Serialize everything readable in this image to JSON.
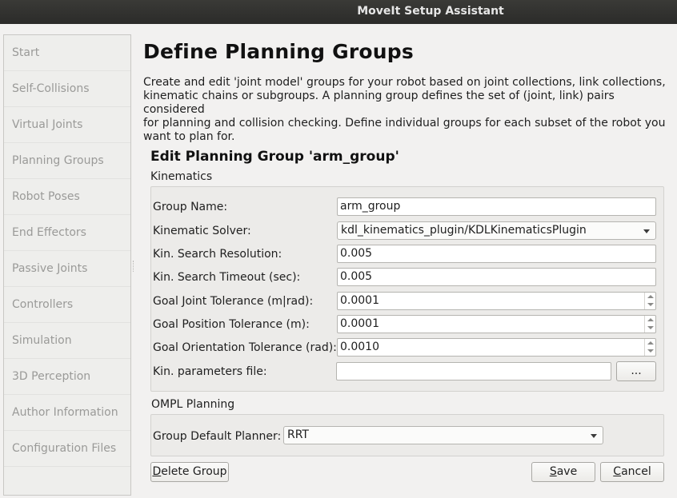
{
  "window": {
    "title": "MoveIt Setup Assistant"
  },
  "sidebar": {
    "items": [
      {
        "label": "Start"
      },
      {
        "label": "Self-Collisions"
      },
      {
        "label": "Virtual Joints"
      },
      {
        "label": "Planning Groups"
      },
      {
        "label": "Robot Poses"
      },
      {
        "label": "End Effectors"
      },
      {
        "label": "Passive Joints"
      },
      {
        "label": "Controllers"
      },
      {
        "label": "Simulation"
      },
      {
        "label": "3D Perception"
      },
      {
        "label": "Author Information"
      },
      {
        "label": "Configuration Files"
      }
    ]
  },
  "main": {
    "title": "Define Planning Groups",
    "description_lines": [
      "Create and edit 'joint model' groups for your robot based on joint collections, link collections,",
      "kinematic chains or subgroups. A planning group defines the set of (joint, link) pairs considered",
      "for planning and collision checking. Define individual groups for each subset of the robot you",
      "want to plan for."
    ],
    "edit_title": "Edit Planning Group 'arm_group'",
    "kinematics": {
      "label": "Kinematics",
      "group_name": {
        "label": "Group Name:",
        "value": "arm_group"
      },
      "solver": {
        "label": "Kinematic Solver:",
        "value": "kdl_kinematics_plugin/KDLKinematicsPlugin"
      },
      "search_resolution": {
        "label": "Kin. Search Resolution:",
        "value": "0.005"
      },
      "search_timeout": {
        "label": "Kin. Search Timeout (sec):",
        "value": "0.005"
      },
      "goal_joint_tol": {
        "label": "Goal Joint Tolerance (m|rad):",
        "value": "0.0001"
      },
      "goal_position_tol": {
        "label": "Goal Position Tolerance (m):",
        "value": "0.0001"
      },
      "goal_orientation_tol": {
        "label": "Goal Orientation Tolerance (rad):",
        "value": "0.0010"
      },
      "params_file": {
        "label": "Kin. parameters file:",
        "value": "",
        "browse_label": "..."
      }
    },
    "ompl": {
      "label": "OMPL Planning",
      "default_planner": {
        "label": "Group Default Planner:",
        "value": "RRT"
      }
    },
    "buttons": {
      "delete": {
        "first": "D",
        "rest": "elete Group"
      },
      "save": {
        "first": "S",
        "rest": "ave"
      },
      "cancel": {
        "first": "C",
        "rest": "ancel"
      }
    }
  },
  "colors": {
    "titlebar": "#2f2f2d",
    "window_bg": "#f2f1f0",
    "sidebar_text_disabled": "#9a9a98"
  }
}
